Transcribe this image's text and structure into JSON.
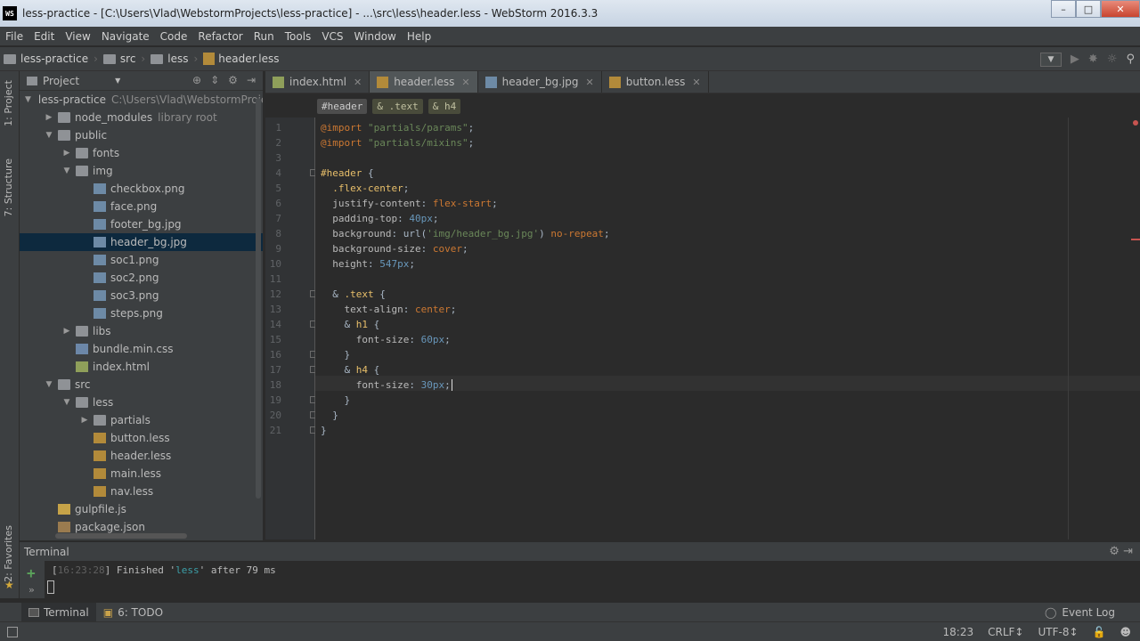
{
  "window": {
    "app_icon": "WS",
    "title": "less-practice - [C:\\Users\\Vlad\\WebstormProjects\\less-practice] - ...\\src\\less\\header.less - WebStorm 2016.3.3"
  },
  "menu": [
    "File",
    "Edit",
    "View",
    "Navigate",
    "Code",
    "Refactor",
    "Run",
    "Tools",
    "VCS",
    "Window",
    "Help"
  ],
  "breadcrumbs": [
    "less-practice",
    "src",
    "less",
    "header.less"
  ],
  "left_strip": {
    "project_tab": "1: Project",
    "structure_tab": "7: Structure",
    "favorites_tab": "2: Favorites"
  },
  "project_panel": {
    "title": "Project",
    "tree": [
      {
        "label": "less-practice",
        "hint": "C:\\Users\\Vlad\\WebstormProje",
        "icon": "folder-icon",
        "depth": 0,
        "open": true
      },
      {
        "label": "node_modules",
        "hint": "library root",
        "icon": "folder-icon",
        "depth": 1,
        "open": false
      },
      {
        "label": "public",
        "icon": "folder-icon",
        "depth": 1,
        "open": true
      },
      {
        "label": "fonts",
        "icon": "folder-icon",
        "depth": 2,
        "open": false
      },
      {
        "label": "img",
        "icon": "folder-icon",
        "depth": 2,
        "open": true
      },
      {
        "label": "checkbox.png",
        "icon": "image-file-icon",
        "depth": 3
      },
      {
        "label": "face.png",
        "icon": "image-file-icon",
        "depth": 3
      },
      {
        "label": "footer_bg.jpg",
        "icon": "image-file-icon",
        "depth": 3
      },
      {
        "label": "header_bg.jpg",
        "icon": "image-file-icon",
        "depth": 3,
        "selected": true
      },
      {
        "label": "soc1.png",
        "icon": "image-file-icon",
        "depth": 3
      },
      {
        "label": "soc2.png",
        "icon": "image-file-icon",
        "depth": 3
      },
      {
        "label": "soc3.png",
        "icon": "image-file-icon",
        "depth": 3
      },
      {
        "label": "steps.png",
        "icon": "image-file-icon",
        "depth": 3
      },
      {
        "label": "libs",
        "icon": "folder-icon",
        "depth": 2,
        "open": false
      },
      {
        "label": "bundle.min.css",
        "icon": "css-file-icon",
        "depth": 2
      },
      {
        "label": "index.html",
        "icon": "html-file-icon",
        "depth": 2
      },
      {
        "label": "src",
        "icon": "folder-icon",
        "depth": 1,
        "open": true
      },
      {
        "label": "less",
        "icon": "folder-icon",
        "depth": 2,
        "open": true
      },
      {
        "label": "partials",
        "icon": "folder-icon",
        "depth": 3,
        "open": false
      },
      {
        "label": "button.less",
        "icon": "less-file-icon",
        "depth": 3
      },
      {
        "label": "header.less",
        "icon": "less-file-icon",
        "depth": 3
      },
      {
        "label": "main.less",
        "icon": "less-file-icon",
        "depth": 3
      },
      {
        "label": "nav.less",
        "icon": "less-file-icon",
        "depth": 3
      },
      {
        "label": "gulpfile.js",
        "icon": "js-file-icon",
        "depth": 1
      },
      {
        "label": "package.json",
        "icon": "json-file-icon",
        "depth": 1
      }
    ]
  },
  "editor_tabs": [
    {
      "label": "index.html",
      "icon": "html-file-icon",
      "active": false
    },
    {
      "label": "header.less",
      "icon": "less-file-icon",
      "active": true
    },
    {
      "label": "header_bg.jpg",
      "icon": "image-file-icon",
      "active": false
    },
    {
      "label": "button.less",
      "icon": "less-file-icon",
      "active": false
    }
  ],
  "editor_breadcrumbs": [
    "#header",
    "& .text",
    "& h4"
  ],
  "code_lines": [
    [
      [
        "k-at",
        "@import "
      ],
      [
        "k-str",
        "\"partials/params\""
      ],
      [
        "k-amp",
        ";"
      ]
    ],
    [
      [
        "k-at",
        "@import "
      ],
      [
        "k-str",
        "\"partials/mixins\""
      ],
      [
        "k-amp",
        ";"
      ]
    ],
    [],
    [
      [
        "k-sel",
        "#header"
      ],
      [
        "k-amp",
        " {"
      ]
    ],
    [
      [
        "k-amp",
        "  "
      ],
      [
        "k-sel",
        ".flex-center"
      ],
      [
        "k-amp",
        ";"
      ]
    ],
    [
      [
        "k-prop",
        "  justify-content"
      ],
      [
        "k-amp",
        ": "
      ],
      [
        "k-val",
        "flex-start"
      ],
      [
        "k-amp",
        ";"
      ]
    ],
    [
      [
        "k-prop",
        "  padding-top"
      ],
      [
        "k-amp",
        ": "
      ],
      [
        "k-num",
        "40px"
      ],
      [
        "k-amp",
        ";"
      ]
    ],
    [
      [
        "k-prop",
        "  background"
      ],
      [
        "k-amp",
        ": url("
      ],
      [
        "k-str",
        "'img/header_bg.jpg'"
      ],
      [
        "k-amp",
        ") "
      ],
      [
        "k-val",
        "no-repeat"
      ],
      [
        "k-amp",
        ";"
      ]
    ],
    [
      [
        "k-prop",
        "  background-size"
      ],
      [
        "k-amp",
        ": "
      ],
      [
        "k-val",
        "cover"
      ],
      [
        "k-amp",
        ";"
      ]
    ],
    [
      [
        "k-prop",
        "  height"
      ],
      [
        "k-amp",
        ": "
      ],
      [
        "k-num",
        "547px"
      ],
      [
        "k-amp",
        ";"
      ]
    ],
    [],
    [
      [
        "k-amp",
        "  & "
      ],
      [
        "k-sel",
        ".text"
      ],
      [
        "k-amp",
        " {"
      ]
    ],
    [
      [
        "k-prop",
        "    text-align"
      ],
      [
        "k-amp",
        ": "
      ],
      [
        "k-val",
        "center"
      ],
      [
        "k-amp",
        ";"
      ]
    ],
    [
      [
        "k-amp",
        "    & "
      ],
      [
        "k-sel",
        "h1"
      ],
      [
        "k-amp",
        " {"
      ]
    ],
    [
      [
        "k-prop",
        "      font-size"
      ],
      [
        "k-amp",
        ": "
      ],
      [
        "k-num",
        "60px"
      ],
      [
        "k-amp",
        ";"
      ]
    ],
    [
      [
        "k-amp",
        "    }"
      ]
    ],
    [
      [
        "k-amp",
        "    & "
      ],
      [
        "k-sel",
        "h4"
      ],
      [
        "k-amp",
        " {"
      ]
    ],
    [
      [
        "k-prop",
        "      font-size"
      ],
      [
        "k-amp",
        ": "
      ],
      [
        "k-num",
        "30px"
      ],
      [
        "k-amp",
        ";"
      ]
    ],
    [
      [
        "k-amp",
        "    }"
      ]
    ],
    [
      [
        "k-amp",
        "  }"
      ]
    ],
    [
      [
        "k-amp",
        "}"
      ]
    ]
  ],
  "terminal": {
    "title": "Terminal",
    "time": "16:23:28",
    "message_prefix": "] Finished '",
    "task": "less",
    "message_suffix": "' after 79 ms"
  },
  "bottom_tools": {
    "terminal": "Terminal",
    "todo": "6: TODO",
    "event_log": "Event Log"
  },
  "status": {
    "position": "18:23",
    "line_separator": "CRLF",
    "encoding": "UTF-8"
  },
  "colors": {
    "selection": "#0d293e",
    "keyword": "#cc7832",
    "string": "#6a8759",
    "number": "#6897bb",
    "selector": "#e8bf6a"
  }
}
